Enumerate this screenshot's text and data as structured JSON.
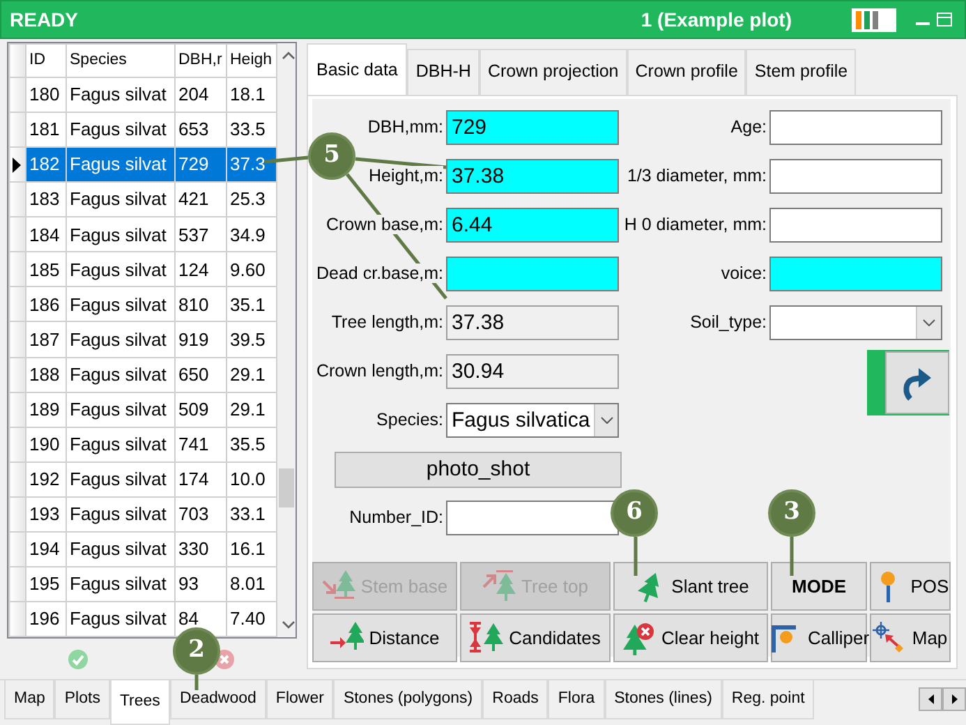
{
  "title_bar": {
    "status": "READY",
    "plot": "1 (Example plot)"
  },
  "table": {
    "columns": [
      "ID",
      "Species",
      "DBH,r",
      "Heigh"
    ],
    "rows": [
      {
        "cells": [
          "180",
          "Fagus silvat",
          "204",
          "18.1"
        ],
        "selected": false
      },
      {
        "cells": [
          "181",
          "Fagus silvat",
          "653",
          "33.5"
        ],
        "selected": false
      },
      {
        "cells": [
          "182",
          "Fagus silvat",
          "729",
          "37.3"
        ],
        "selected": true
      },
      {
        "cells": [
          "183",
          "Fagus silvat",
          "421",
          "25.3"
        ],
        "selected": false
      },
      {
        "cells": [
          "184",
          "Fagus silvat",
          "537",
          "34.9"
        ],
        "selected": false
      },
      {
        "cells": [
          "185",
          "Fagus silvat",
          "124",
          "9.60"
        ],
        "selected": false
      },
      {
        "cells": [
          "186",
          "Fagus silvat",
          "810",
          "35.1"
        ],
        "selected": false
      },
      {
        "cells": [
          "187",
          "Fagus silvat",
          "919",
          "39.5"
        ],
        "selected": false
      },
      {
        "cells": [
          "188",
          "Fagus silvat",
          "650",
          "29.1"
        ],
        "selected": false
      },
      {
        "cells": [
          "189",
          "Fagus silvat",
          "509",
          "29.1"
        ],
        "selected": false
      },
      {
        "cells": [
          "190",
          "Fagus silvat",
          "741",
          "35.5"
        ],
        "selected": false
      },
      {
        "cells": [
          "192",
          "Fagus silvat",
          "174",
          "10.0"
        ],
        "selected": false
      },
      {
        "cells": [
          "193",
          "Fagus silvat",
          "703",
          "33.1"
        ],
        "selected": false
      },
      {
        "cells": [
          "194",
          "Fagus silvat",
          "330",
          "16.1"
        ],
        "selected": false
      },
      {
        "cells": [
          "195",
          "Fagus silvat",
          "93",
          "8.01"
        ],
        "selected": false
      },
      {
        "cells": [
          "196",
          "Fagus silvat",
          "84",
          "7.40"
        ],
        "selected": false
      }
    ]
  },
  "detail_tabs": [
    {
      "label": "Basic data",
      "selected": true
    },
    {
      "label": "DBH-H",
      "selected": false
    },
    {
      "label": "Crown projection",
      "selected": false
    },
    {
      "label": "Crown profile",
      "selected": false
    },
    {
      "label": "Stem profile",
      "selected": false
    }
  ],
  "fields_left": [
    {
      "label": "DBH,mm:",
      "value": "729",
      "kind": "input",
      "highlighted": true
    },
    {
      "label": "Height,m:",
      "value": "37.38",
      "kind": "input",
      "highlighted": true
    },
    {
      "label": "Crown base,m:",
      "value": "6.44",
      "kind": "input",
      "highlighted": true
    },
    {
      "label": "Dead cr.base,m:",
      "kind": "input",
      "highlighted": true
    },
    {
      "label": "Tree length,m:",
      "value": "37.38",
      "kind": "readonly",
      "highlighted": false
    },
    {
      "label": "Crown length,m:",
      "value": "30.94",
      "kind": "readonly",
      "highlighted": false
    },
    {
      "label": "Species:",
      "value": "Fagus silvatica",
      "kind": "select",
      "highlighted": false
    }
  ],
  "fields_right": [
    {
      "label": "Age:",
      "kind": "input",
      "highlighted": false
    },
    {
      "label": "1/3 diameter, mm:",
      "kind": "input",
      "highlighted": false
    },
    {
      "label": "H 0 diameter, mm:",
      "kind": "input",
      "highlighted": false
    },
    {
      "label": "voice:",
      "kind": "input",
      "highlighted": true
    },
    {
      "label": "Soil_type:",
      "kind": "select",
      "highlighted": false
    }
  ],
  "photo_button": "photo_shot",
  "number_id": {
    "label": "Number_ID:"
  },
  "action_buttons": [
    {
      "label": "Stem base",
      "kind": "stem-base",
      "disabled": true
    },
    {
      "label": "Tree top",
      "kind": "tree-top",
      "disabled": true
    },
    {
      "label": "Slant tree",
      "kind": "slant",
      "disabled": false
    },
    {
      "label": "MODE",
      "kind": "plain",
      "disabled": false
    },
    {
      "label": "POS",
      "kind": "pos",
      "disabled": false
    },
    {
      "label": "Distance",
      "kind": "distance",
      "disabled": false
    },
    {
      "label": "Candidates",
      "kind": "candidates",
      "disabled": false
    },
    {
      "label": "Clear height",
      "kind": "clear",
      "disabled": false
    },
    {
      "label": "Calliper",
      "kind": "calliper",
      "disabled": false
    },
    {
      "label": "Map",
      "kind": "map",
      "disabled": false
    }
  ],
  "bottom_tabs": [
    {
      "label": "Map",
      "selected": false
    },
    {
      "label": "Plots",
      "selected": false
    },
    {
      "label": "Trees",
      "selected": true
    },
    {
      "label": "Deadwood",
      "selected": false
    },
    {
      "label": "Flower",
      "selected": false
    },
    {
      "label": "Stones (polygons)",
      "selected": false
    },
    {
      "label": "Roads",
      "selected": false
    },
    {
      "label": "Flora",
      "selected": false
    },
    {
      "label": "Stones (lines)",
      "selected": false
    },
    {
      "label": "Reg. point",
      "selected": false
    }
  ],
  "callouts": [
    {
      "number": "5"
    },
    {
      "number": "6"
    },
    {
      "number": "3"
    },
    {
      "number": "2"
    }
  ]
}
